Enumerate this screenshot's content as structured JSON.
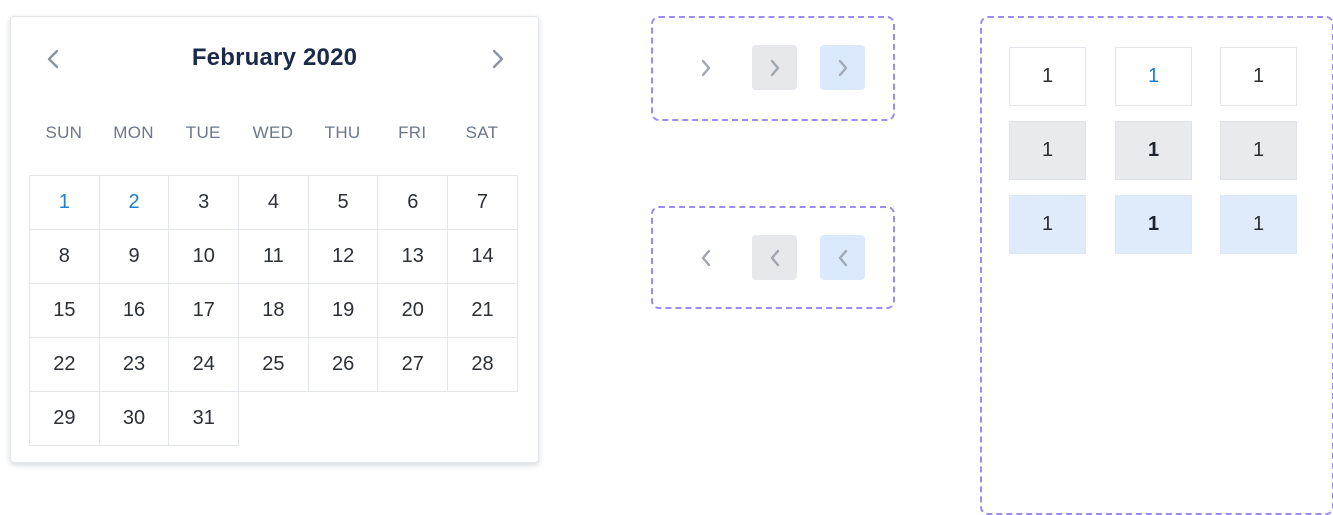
{
  "colors": {
    "accent": "#1f7ed0",
    "title": "#1c2a4a",
    "weekday": "#6b7789",
    "dash_border": "#9b8cf3",
    "hover_bg": "#e7e8eb",
    "active_bg": "#dbe9fd"
  },
  "calendar": {
    "title": "February 2020",
    "prev_icon": "chevron-left-icon",
    "next_icon": "chevron-right-icon",
    "weekdays": [
      "SUN",
      "MON",
      "TUE",
      "WED",
      "THU",
      "FRI",
      "SAT"
    ],
    "days": [
      "1",
      "2",
      "3",
      "4",
      "5",
      "6",
      "7",
      "8",
      "9",
      "10",
      "11",
      "12",
      "13",
      "14",
      "15",
      "16",
      "17",
      "18",
      "19",
      "20",
      "21",
      "22",
      "23",
      "24",
      "25",
      "26",
      "27",
      "28",
      "29",
      "30",
      "31"
    ],
    "accent_days": [
      "1",
      "2"
    ]
  },
  "arrow_states": {
    "icons": {
      "next": "chevron-right-icon",
      "prev": "chevron-left-icon"
    },
    "states": [
      "normal",
      "hover",
      "active"
    ]
  },
  "cell_states": {
    "rows": [
      {
        "state": "normal",
        "values": [
          "1",
          "1",
          "1"
        ]
      },
      {
        "state": "hover",
        "values": [
          "1",
          "1",
          "1"
        ]
      },
      {
        "state": "active",
        "values": [
          "1",
          "1",
          "1"
        ]
      }
    ]
  }
}
